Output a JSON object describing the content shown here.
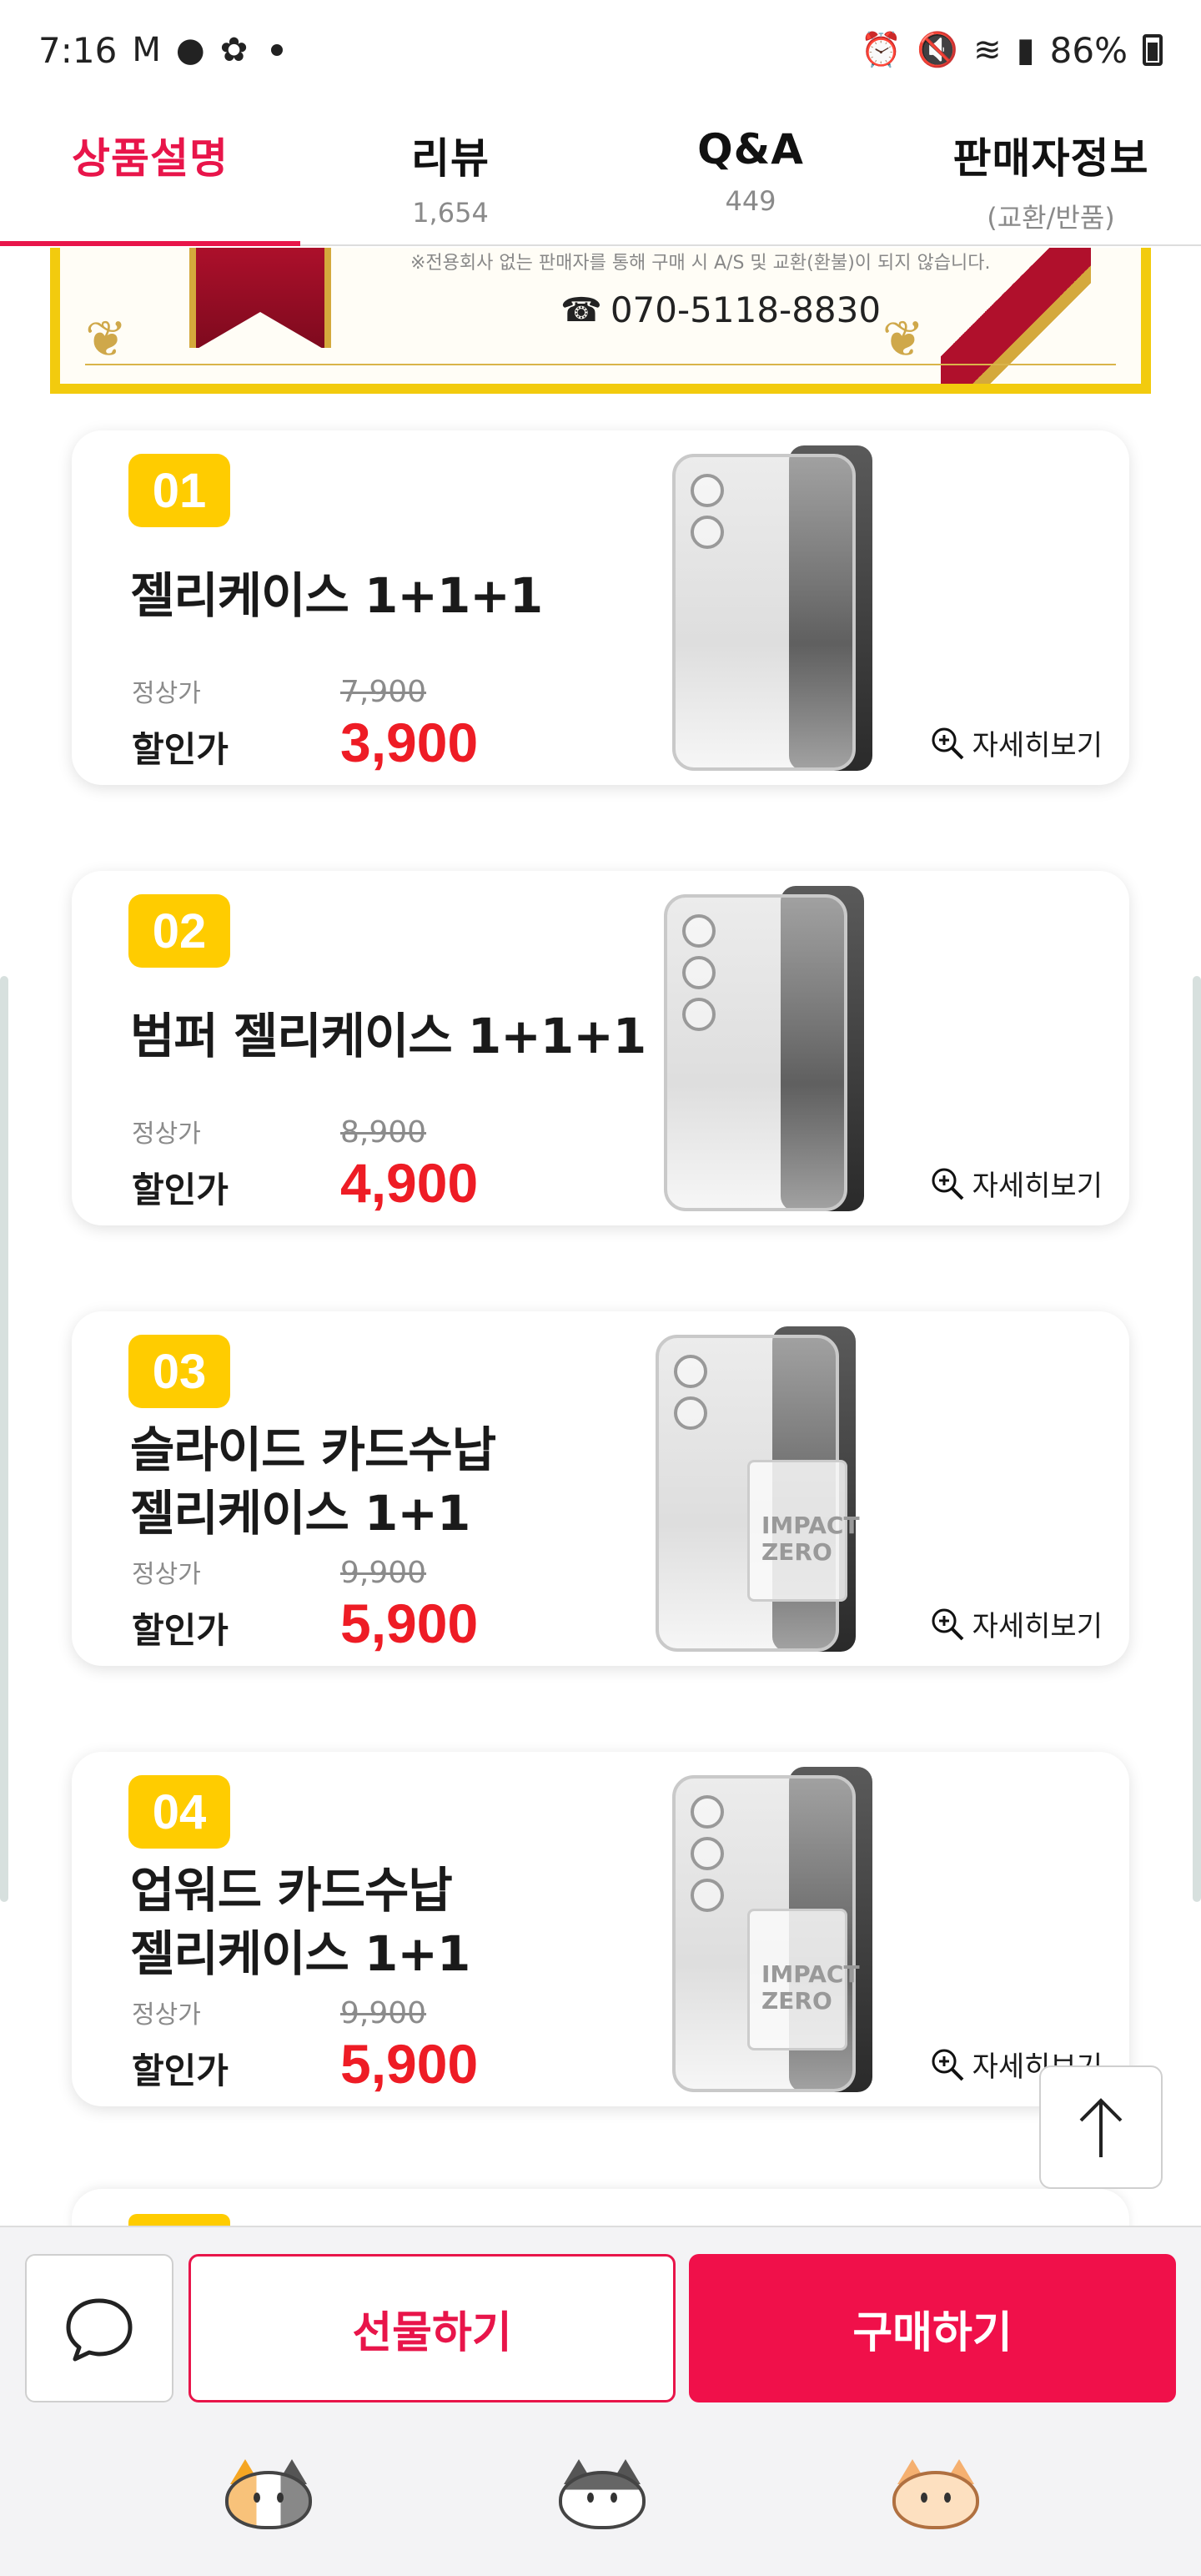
{
  "status_bar": {
    "time": "7:16",
    "battery": "86%",
    "icons_left": [
      "gmail-icon",
      "chat-bubble-icon",
      "fan-icon",
      "dot-icon"
    ],
    "icons_right": [
      "alarm-icon",
      "mute-icon",
      "wifi-icon",
      "signal-icon",
      "battery-icon"
    ]
  },
  "tabs": [
    {
      "label": "상품설명",
      "sub": ""
    },
    {
      "label": "리뷰",
      "sub": "1,654"
    },
    {
      "label": "Q&A",
      "sub": "449"
    },
    {
      "label": "판매자정보",
      "sub": "(교환/반품)"
    }
  ],
  "banner": {
    "note": "※전용회사 없는 판매자를 통해 구매 시 A/S 및 교환(환불)이 되지 않습니다.",
    "phone": "070-5118-8830"
  },
  "products": [
    {
      "num": "01",
      "title": "젤리케이스 1+1+1",
      "regular_label": "정상가",
      "regular_price": "7,900",
      "sale_label": "할인가",
      "sale_price": "3,900",
      "detail": "자세히보기"
    },
    {
      "num": "02",
      "title": "범퍼 젤리케이스 1+1+1",
      "regular_label": "정상가",
      "regular_price": "8,900",
      "sale_label": "할인가",
      "sale_price": "4,900",
      "detail": "자세히보기"
    },
    {
      "num": "03",
      "title": "슬라이드 카드수납\n젤리케이스 1+1",
      "regular_label": "정상가",
      "regular_price": "9,900",
      "sale_label": "할인가",
      "sale_price": "5,900",
      "detail": "자세히보기"
    },
    {
      "num": "04",
      "title": "업워드 카드수납\n젤리케이스 1+1",
      "regular_label": "정상가",
      "regular_price": "9,900",
      "sale_label": "할인가",
      "sale_price": "5,900",
      "detail": "자세히보기"
    }
  ],
  "case_label": "IMPACT\nZERO",
  "actions": {
    "gift": "선물하기",
    "buy": "구매하기"
  },
  "colors": {
    "accent": "#e8154a",
    "sale": "#ee1c25",
    "badge": "#ffcc00"
  }
}
